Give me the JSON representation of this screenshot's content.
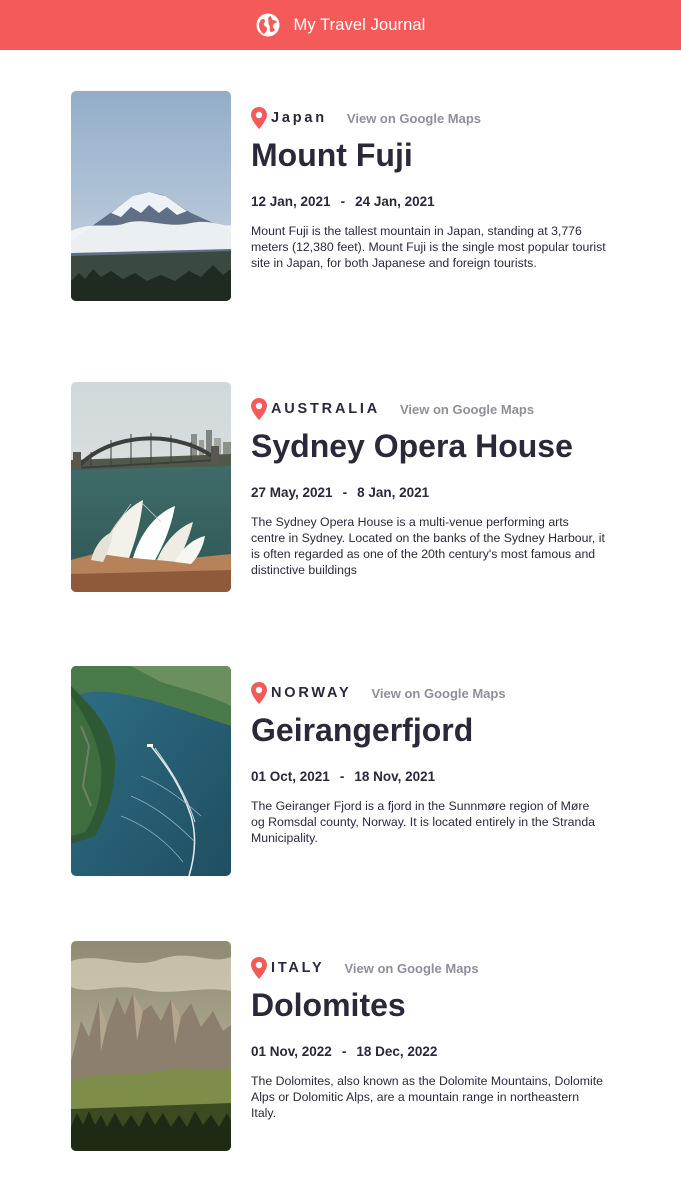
{
  "header": {
    "title": "My Travel Journal",
    "icon": "globe-icon"
  },
  "entries": [
    {
      "country": "Japan",
      "maps_link": "View on Google Maps",
      "place": "Mount Fuji",
      "start_date": "12 Jan, 2021",
      "end_date": "24 Jan, 2021",
      "date_separator": "-",
      "description": "Mount Fuji is the tallest mountain in Japan, standing at 3,776 meters (12,380 feet). Mount Fuji is the single most popular tourist site in Japan, for both Japanese and foreign tourists."
    },
    {
      "country": "AUSTRALIA",
      "maps_link": "View on Google Maps",
      "place": "Sydney Opera House",
      "start_date": "27 May, 2021",
      "end_date": "8 Jan, 2021",
      "date_separator": "-",
      "description": "The Sydney Opera House is a multi-venue performing arts centre in Sydney. Located on the banks of the Sydney Harbour, it is often regarded as one of the 20th century's most famous and distinctive buildings"
    },
    {
      "country": "NORWAY",
      "maps_link": "View on Google Maps",
      "place": "Geirangerfjord",
      "start_date": "01 Oct, 2021",
      "end_date": "18 Nov, 2021",
      "date_separator": "-",
      "description": "The Geiranger Fjord is a fjord in the Sunnmøre region of Møre og Romsdal county, Norway. It is located entirely in the Stranda Municipality."
    },
    {
      "country": "ITALY",
      "maps_link": "View on Google Maps",
      "place": "Dolomites",
      "start_date": "01 Nov, 2022",
      "end_date": "18 Dec, 2022",
      "date_separator": "-",
      "description": "The Dolomites, also known as the Dolomite Mountains, Dolomite Alps or Dolomitic Alps, are a mountain range in northeastern Italy."
    }
  ],
  "colors": {
    "accent": "#f55a5a",
    "text": "#2b283a",
    "muted": "#918e9b"
  }
}
